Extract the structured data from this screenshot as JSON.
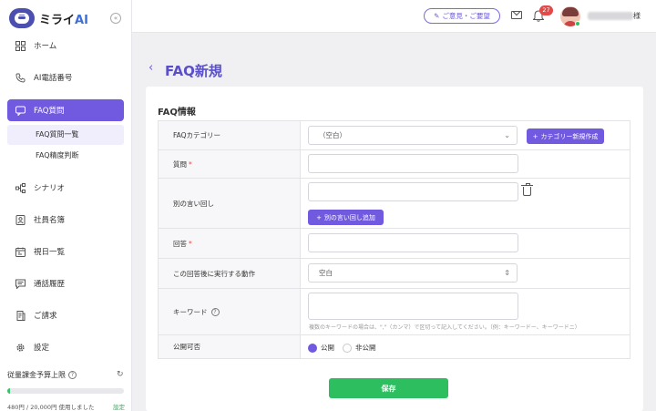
{
  "app": {
    "logo_text": "ミライ",
    "logo_ai": "AI"
  },
  "sidebar": {
    "items": [
      {
        "label": "ホーム",
        "icon": "grid-icon"
      },
      {
        "label": "AI電話番号",
        "icon": "phone-icon"
      },
      {
        "label": "FAQ質問",
        "icon": "faq-icon"
      },
      {
        "label": "シナリオ",
        "icon": "flow-icon"
      },
      {
        "label": "社員名簿",
        "icon": "contact-icon"
      },
      {
        "label": "視日一覧",
        "icon": "calendar-icon"
      },
      {
        "label": "通話履歴",
        "icon": "chat-icon"
      },
      {
        "label": "ご請求",
        "icon": "invoice-icon"
      },
      {
        "label": "設定",
        "icon": "gear-icon"
      }
    ],
    "sub_items": [
      {
        "label": "FAQ質問一覧"
      },
      {
        "label": "FAQ精度判断"
      }
    ],
    "budget": {
      "label": "従量課金予算上限",
      "text": "480円 / 20,000円 使用しました",
      "setting_label": "設定",
      "used_fraction": 0.024
    }
  },
  "header": {
    "feedback_label": "ご意見・ご要望",
    "notification_count": "27",
    "user_suffix": "様"
  },
  "page": {
    "title": "FAQ新規",
    "section_title": "FAQ情報"
  },
  "form": {
    "category_label": "FAQカテゴリー",
    "category_value": "（空白）",
    "new_category_button": "カテゴリー新規作成",
    "question_label": "質問",
    "alt_phrase_label": "別の言い回し",
    "add_alt_button": "別の言い回し追加",
    "answer_label": "回答",
    "action_label": "この回答後に実行する動作",
    "action_value": "空白",
    "keyword_label": "キーワード",
    "keyword_hint": "複数のキーワードの場合は、\",\"（カンマ）で区切って記入してください。（例：キーワードー、キーワードニ）",
    "visibility_label": "公開可否",
    "public_label": "公開",
    "private_label": "非公開",
    "required_mark": "*"
  },
  "actions": {
    "save_label": "保存"
  }
}
